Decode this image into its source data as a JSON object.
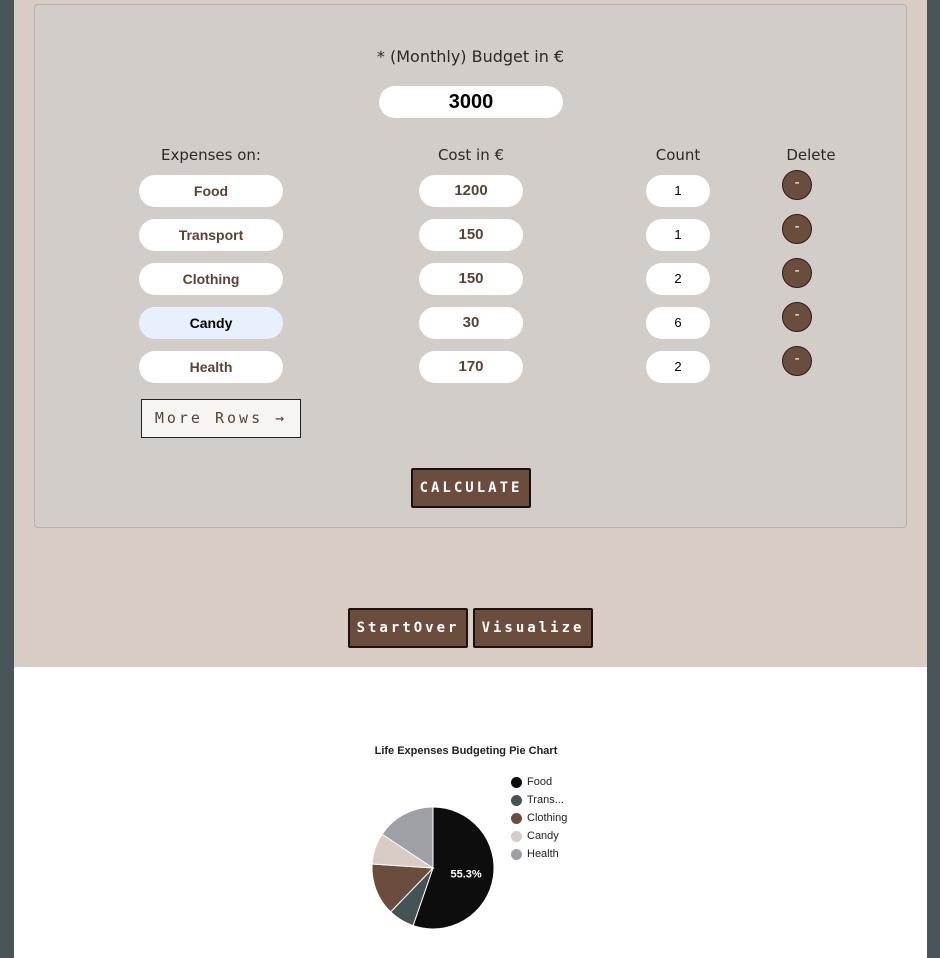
{
  "form": {
    "budget_label": "* (Monthly) Budget in €",
    "budget_value": "3000",
    "headers": {
      "expenses": "Expenses on:",
      "cost": "Cost in €",
      "count": "Count",
      "delete": "Delete"
    },
    "rows": [
      {
        "name": "Food",
        "cost": "1200",
        "count": "1",
        "delete": "-"
      },
      {
        "name": "Transport",
        "cost": "150",
        "count": "1",
        "delete": "-"
      },
      {
        "name": "Clothing",
        "cost": "150",
        "count": "2",
        "delete": "-"
      },
      {
        "name": "Candy",
        "cost": "30",
        "count": "6",
        "delete": "-"
      },
      {
        "name": "Health",
        "cost": "170",
        "count": "2",
        "delete": "-"
      }
    ],
    "more_rows_label": "More Rows →",
    "calculate_label": "CALCULATE"
  },
  "actions": {
    "start_over_label": "StartOver",
    "visualize_label": "Visualize"
  },
  "chart_data": {
    "type": "pie",
    "title": "Life Expenses Budgeting Pie Chart",
    "categories": [
      "Food",
      "Trans...",
      "Clothing",
      "Candy",
      "Health"
    ],
    "values": [
      1200,
      150,
      300,
      180,
      340
    ],
    "colors": [
      "#0d0d0d",
      "#475257",
      "#6b4d3d",
      "#d8ccc5",
      "#9ea0a5"
    ],
    "slice_labels": [
      "55.3%",
      "",
      "",
      "",
      ""
    ],
    "legend_position": "right"
  }
}
